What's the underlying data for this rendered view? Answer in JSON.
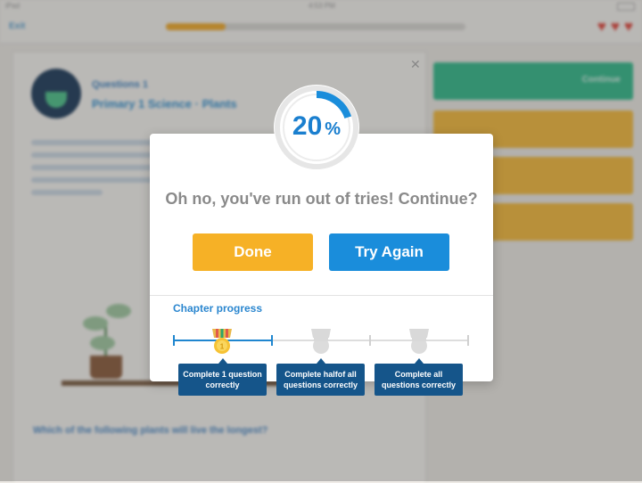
{
  "status_bar": {
    "carrier": "iPad",
    "time": "4:53 PM"
  },
  "topbar": {
    "exit_label": "Exit",
    "progress_fraction": 0.2
  },
  "hearts": {
    "count": 3,
    "color": "#e0463c"
  },
  "lesson": {
    "kicker": "Questions 1",
    "title": "Primary 1 Science · Plants",
    "question": "Which of the following plants will live the longest?"
  },
  "side": {
    "continue_label": "Continue"
  },
  "modal": {
    "score_value": "20",
    "score_unit": "%",
    "score_fraction": 0.2,
    "message": "Oh no, you've run out of tries! Continue?",
    "done_label": "Done",
    "retry_label": "Try Again",
    "chapter_progress_label": "Chapter progress",
    "milestones": [
      {
        "label": "Complete 1 question correctly",
        "achieved": true
      },
      {
        "label": "Complete halfof all questions correctly",
        "achieved": false
      },
      {
        "label": "Complete all questions correctly",
        "achieved": false
      }
    ]
  },
  "colors": {
    "accent_blue": "#1a8ddb",
    "done_yellow": "#f6b126",
    "badge_navy": "#15558a",
    "success_green": "#31b98a"
  }
}
